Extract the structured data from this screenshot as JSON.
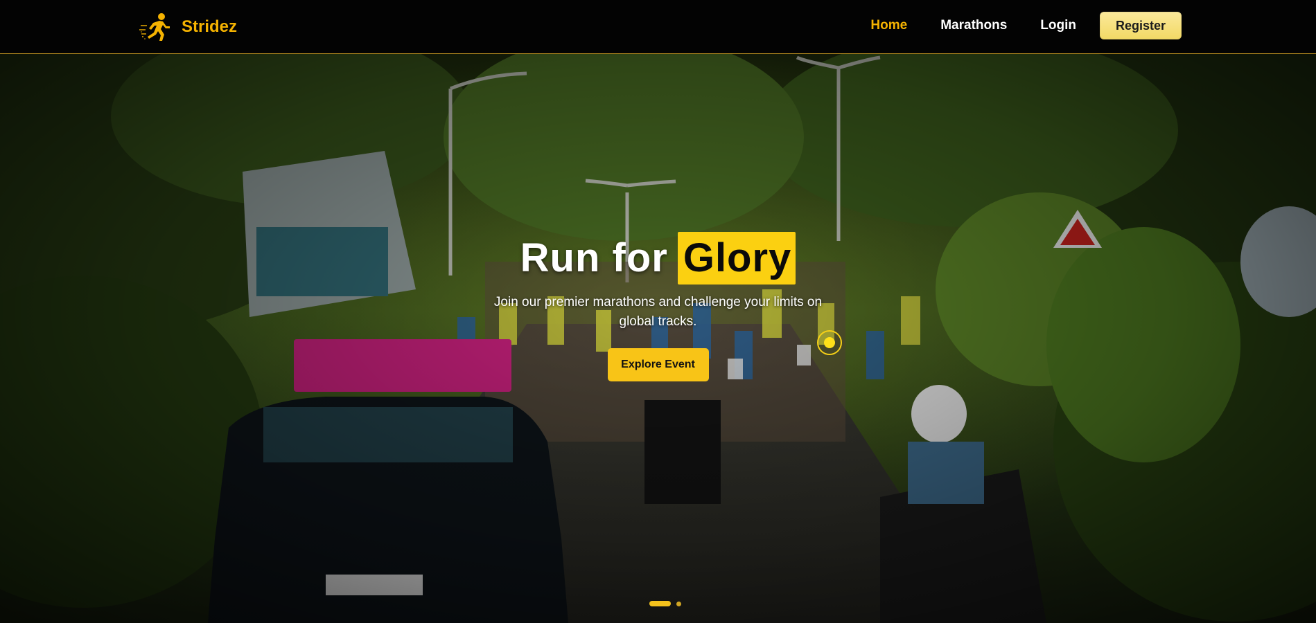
{
  "navbar": {
    "brand_name": "Stridez",
    "links": [
      {
        "label": "Home",
        "active": true
      },
      {
        "label": "Marathons",
        "active": false
      },
      {
        "label": "Login",
        "active": false
      }
    ],
    "register_label": "Register"
  },
  "hero": {
    "title_prefix": "Run for",
    "title_highlight": "Glory",
    "subtitle": "Join our premier marathons and challenge your limits on global tracks.",
    "cta_label": "Explore Event",
    "carousel": {
      "slide_count": 2,
      "active_slide": 1
    }
  },
  "theme": {
    "accent": "#f5b301",
    "highlight": "#fbd011",
    "navbar_bg": "#030303"
  },
  "icons": {
    "brand": "runner-icon"
  }
}
